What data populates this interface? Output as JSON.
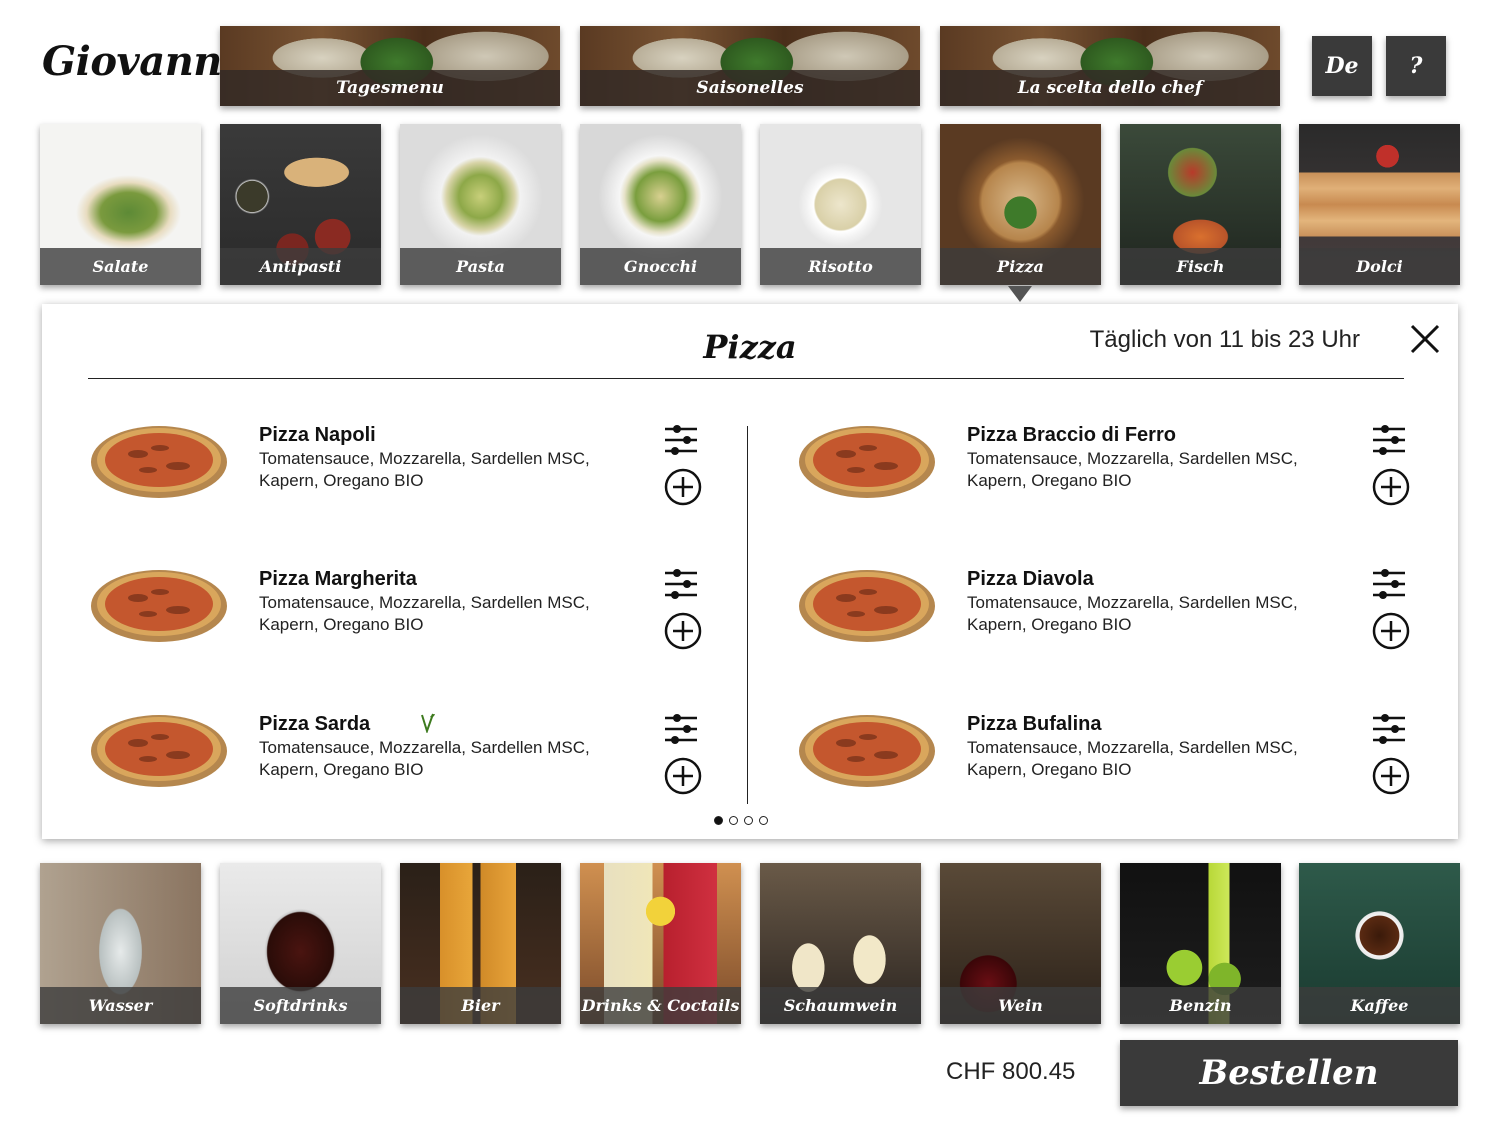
{
  "brand": "Giovanni",
  "banners": [
    "Tagesmenu",
    "Saisonelles",
    "La scelta dello chef"
  ],
  "header_buttons": {
    "language": "De",
    "help": "?"
  },
  "food_categories": [
    "Salate",
    "Antipasti",
    "Pasta",
    "Gnocchi",
    "Risotto",
    "Pizza",
    "Fisch",
    "Dolci"
  ],
  "selected_category": "Pizza",
  "panel": {
    "title": "Pizza",
    "hours": "Täglich von 11 bis 23 Uhr",
    "items": [
      {
        "name": "Pizza Napoli",
        "description": "Tomatensauce, Mozzarella, Sardellen MSC, Kapern, Oregano BIO",
        "vegetarian": false
      },
      {
        "name": "Pizza Braccio di Ferro",
        "description": "Tomatensauce, Mozzarella, Sardellen MSC, Kapern, Oregano BIO",
        "vegetarian": false
      },
      {
        "name": "Pizza Margherita",
        "description": "Tomatensauce, Mozzarella, Sardellen MSC, Kapern, Oregano BIO",
        "vegetarian": false
      },
      {
        "name": "Pizza Diavola",
        "description": "Tomatensauce, Mozzarella, Sardellen MSC, Kapern, Oregano BIO",
        "vegetarian": false
      },
      {
        "name": "Pizza Sarda",
        "description": "Tomatensauce, Mozzarella, Sardellen MSC, Kapern, Oregano BIO",
        "vegetarian": true
      },
      {
        "name": "Pizza Bufalina",
        "description": "Tomatensauce, Mozzarella, Sardellen MSC, Kapern, Oregano BIO",
        "vegetarian": false
      }
    ],
    "pagination": {
      "current": 1,
      "total": 4
    }
  },
  "drink_categories": [
    "Wasser",
    "Softdrinks",
    "Bier",
    "Drinks & Coctails",
    "Schaumwein",
    "Wein",
    "Benzin",
    "Kaffee"
  ],
  "footer": {
    "total": "CHF 800.45",
    "order_button": "Bestellen"
  },
  "colors": {
    "button_bg": "#3a3a3a",
    "caption_bg": "#3c3c3c",
    "text": "#111111",
    "background": "#ffffff"
  }
}
